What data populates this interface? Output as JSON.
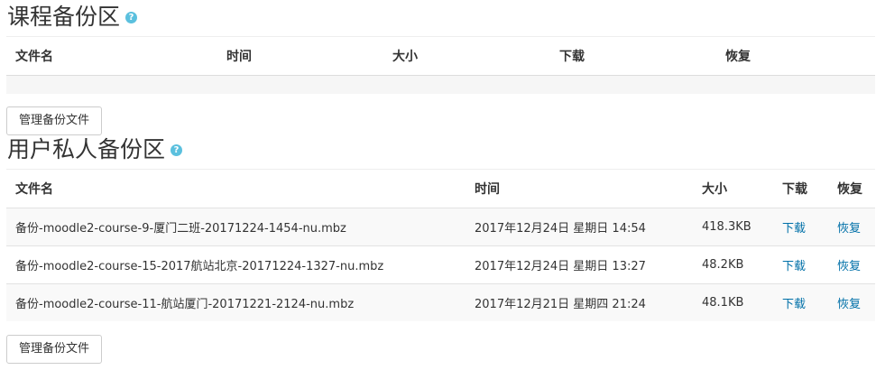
{
  "course_backup": {
    "title": "课程备份区",
    "help_icon": "?",
    "headers": [
      "文件名",
      "时间",
      "大小",
      "下载",
      "恢复"
    ],
    "manage_button": "管理备份文件"
  },
  "user_backup": {
    "title": "用户私人备份区",
    "help_icon": "?",
    "headers": [
      "文件名",
      "时间",
      "大小",
      "下载",
      "恢复"
    ],
    "rows": [
      {
        "filename": "备份-moodle2-course-9-厦门二班-20171224-1454-nu.mbz",
        "time": "2017年12月24日 星期日 14:54",
        "size": "418.3KB",
        "download": "下载",
        "restore": "恢复"
      },
      {
        "filename": "备份-moodle2-course-15-2017航站北京-20171224-1327-nu.mbz",
        "time": "2017年12月24日 星期日 13:27",
        "size": "48.2KB",
        "download": "下载",
        "restore": "恢复"
      },
      {
        "filename": "备份-moodle2-course-11-航站厦门-20171221-2124-nu.mbz",
        "time": "2017年12月21日 星期四 21:24",
        "size": "48.1KB",
        "download": "下载",
        "restore": "恢复"
      }
    ],
    "manage_button": "管理备份文件"
  },
  "colors": {
    "link": "#0070a8",
    "help_icon": "#5bc0de"
  }
}
